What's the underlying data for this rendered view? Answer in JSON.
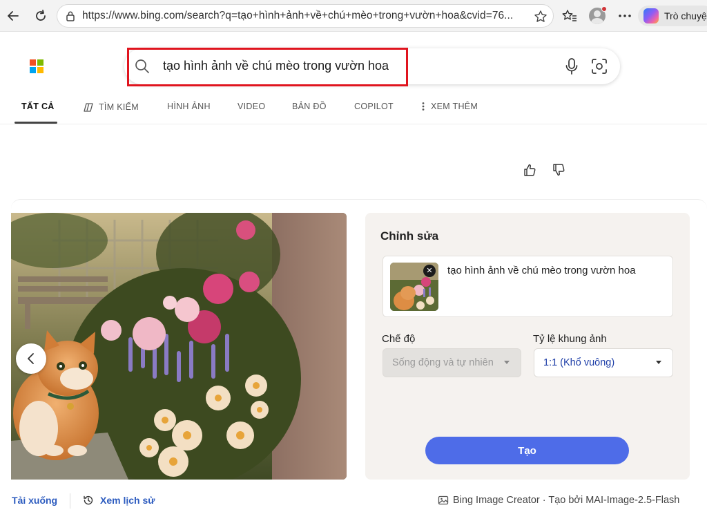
{
  "browser": {
    "url": "https://www.bing.com/search?q=tạo+hình+ảnh+về+chú+mèo+trong+vườn+hoa&cvid=76...",
    "copilot_label": "Trò chuyện"
  },
  "icons": {
    "back": "arrow-left-icon",
    "refresh": "refresh-icon",
    "lock": "lock-icon",
    "favorite": "star-icon",
    "favorites_list": "favorites-icon",
    "more": "more-icon",
    "search": "search-icon",
    "microphone": "microphone-icon",
    "visual_search": "camera-icon",
    "copilot_tab": "copilot-icon",
    "more_tab": "vertical-dots-icon",
    "like": "thumbs-up-icon",
    "dislike": "thumbs-down-icon",
    "previous": "chevron-left-icon",
    "history": "history-icon",
    "image_creator": "image-icon"
  },
  "search": {
    "query": "tạo hình ảnh về chú mèo trong vườn hoa"
  },
  "tabs": [
    "TẤT CẢ",
    "TÌM KIẾM",
    "HÌNH ẢNH",
    "VIDEO",
    "BẢN ĐỒ",
    "COPILOT",
    "XEM THÊM"
  ],
  "editor": {
    "title": "Chỉnh sửa",
    "prompt": "tạo hình ảnh về chú mèo trong vườn hoa",
    "remove_glyph": "✕",
    "mode_label": "Chế độ",
    "mode_value": "Sống động và tự nhiên",
    "ratio_label": "Tỷ lệ khung ảnh",
    "ratio_value": "1:1 (Khổ vuông)",
    "create_label": "Tạo"
  },
  "footer": {
    "download": "Tải xuống",
    "history": "Xem lịch sử",
    "credit": "Bing Image Creator · Tạo bởi MAI-Image-2.5-Flash"
  },
  "colors": {
    "accent": "#4e6ce8",
    "link": "#2c5bbf",
    "highlight": "#e0141e",
    "ms_logo": [
      "#f25022",
      "#7fba00",
      "#00a4ef",
      "#ffb900"
    ]
  }
}
